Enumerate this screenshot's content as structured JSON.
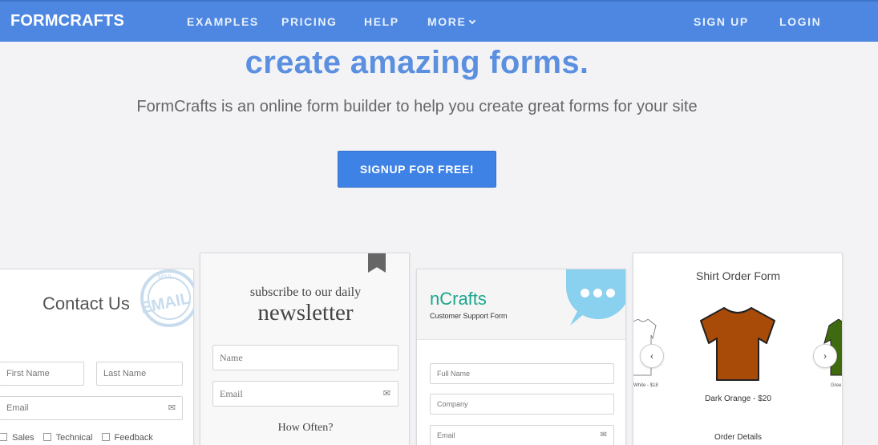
{
  "nav": {
    "logo": "FORMCRAFTS",
    "links": [
      "EXAMPLES",
      "PRICING",
      "HELP",
      "MORE"
    ],
    "signup": "SIGN UP",
    "login": "LOGIN"
  },
  "hero": {
    "title": "create amazing forms.",
    "subtitle": "FormCrafts is an online form builder to help you create great forms for your site",
    "cta": "SIGNUP FOR FREE!"
  },
  "cards": {
    "contact": {
      "title": "Contact Us",
      "stamp_text": "EMAIL",
      "stamp_small": "MAIL",
      "first_name": "First Name",
      "last_name": "Last Name",
      "email": "Email",
      "options": [
        "Sales",
        "Technical",
        "Feedback"
      ]
    },
    "newsletter": {
      "small": "subscribe to our daily",
      "big": "newsletter",
      "name": "Name",
      "email": "Email",
      "question": "How Often?"
    },
    "ncrafts": {
      "title": "nCrafts",
      "subtitle": "Customer Support Form",
      "full_name": "Full Name",
      "company": "Company",
      "email": "Email"
    },
    "shirt": {
      "title": "Shirt Order Form",
      "caption": "Dark Orange - $20",
      "left_caption": "White - $18",
      "right_caption": "Gree",
      "order_details": "Order Details",
      "colors": {
        "orange": "#a84a08",
        "green": "#3f6a10"
      }
    }
  }
}
